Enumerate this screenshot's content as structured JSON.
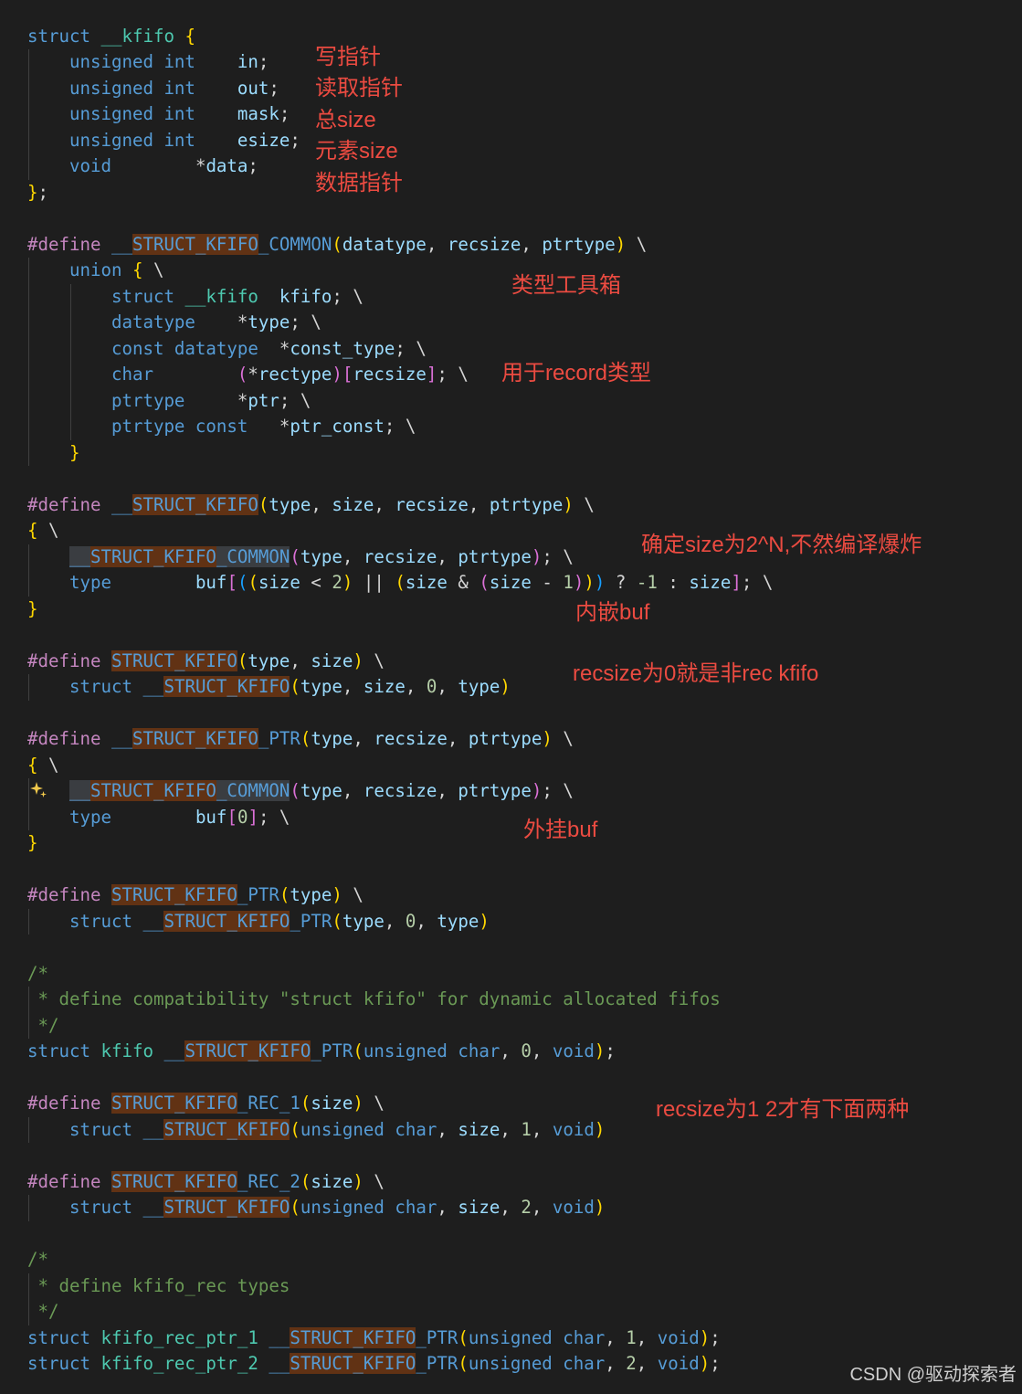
{
  "editor": {
    "theme": {
      "background": "#1e1e1e",
      "keyword": "#569cd6",
      "directive": "#c586c0",
      "macro": "#569cd6",
      "type": "#4ec9b0",
      "identifier": "#9cdcfe",
      "number": "#b5cea8",
      "punctuation": "#d4d4d4",
      "bracket1": "#ffd700",
      "bracket2": "#da70d6",
      "bracket3": "#179fff",
      "comment": "#6a9955",
      "find_match_bg": "#613214",
      "word_highlight_bg": "#3a3d41",
      "indent_guide": "#404040",
      "annotation": "#eb4b41",
      "watermark": "#cfcfcf",
      "sparkle": "#f2c94c"
    },
    "lines": [
      [
        [
          "struct ",
          "keyword"
        ],
        [
          "__kfifo ",
          "type"
        ],
        [
          "{",
          "bracket1"
        ]
      ],
      [
        [
          "    unsigned int    ",
          "keyword"
        ],
        [
          "in",
          "identifier"
        ],
        [
          ";",
          "punctuation"
        ]
      ],
      [
        [
          "    unsigned int    ",
          "keyword"
        ],
        [
          "out",
          "identifier"
        ],
        [
          ";",
          "punctuation"
        ]
      ],
      [
        [
          "    unsigned int    ",
          "keyword"
        ],
        [
          "mask",
          "identifier"
        ],
        [
          ";",
          "punctuation"
        ]
      ],
      [
        [
          "    unsigned int    ",
          "keyword"
        ],
        [
          "esize",
          "identifier"
        ],
        [
          ";",
          "punctuation"
        ]
      ],
      [
        [
          "    void        ",
          "keyword"
        ],
        [
          "*",
          "punctuation"
        ],
        [
          "data",
          "identifier"
        ],
        [
          ";",
          "punctuation"
        ]
      ],
      [
        [
          "}",
          "bracket1"
        ],
        [
          ";",
          "punctuation"
        ]
      ],
      [],
      [
        [
          "#define ",
          "directive"
        ],
        [
          "__",
          "macro"
        ],
        [
          "STRUCT_KFIFO",
          "macro",
          "find"
        ],
        [
          "_COMMON",
          "macro"
        ],
        [
          "(",
          "bracket1"
        ],
        [
          "datatype",
          "identifier"
        ],
        [
          ", ",
          "punctuation"
        ],
        [
          "recsize",
          "identifier"
        ],
        [
          ", ",
          "punctuation"
        ],
        [
          "ptrtype",
          "identifier"
        ],
        [
          ")",
          "bracket1"
        ],
        [
          " \\",
          "punctuation"
        ]
      ],
      [
        [
          "    union ",
          "keyword"
        ],
        [
          "{",
          "bracket1"
        ],
        [
          " \\",
          "punctuation"
        ]
      ],
      [
        [
          "        struct ",
          "keyword"
        ],
        [
          "__kfifo",
          "type"
        ],
        [
          "  kfifo",
          "identifier"
        ],
        [
          "; \\",
          "punctuation"
        ]
      ],
      [
        [
          "        datatype    ",
          "keyword"
        ],
        [
          "*",
          "punctuation"
        ],
        [
          "type",
          "identifier"
        ],
        [
          "; \\",
          "punctuation"
        ]
      ],
      [
        [
          "        const datatype  ",
          "keyword"
        ],
        [
          "*",
          "punctuation"
        ],
        [
          "const_type",
          "identifier"
        ],
        [
          "; \\",
          "punctuation"
        ]
      ],
      [
        [
          "        char        ",
          "keyword"
        ],
        [
          "(",
          "bracket2"
        ],
        [
          "*",
          "punctuation"
        ],
        [
          "rectype",
          "identifier"
        ],
        [
          ")",
          "bracket2"
        ],
        [
          "[",
          "bracket2"
        ],
        [
          "recsize",
          "identifier"
        ],
        [
          "]",
          "bracket2"
        ],
        [
          "; \\",
          "punctuation"
        ]
      ],
      [
        [
          "        ptrtype     ",
          "keyword"
        ],
        [
          "*",
          "punctuation"
        ],
        [
          "ptr",
          "identifier"
        ],
        [
          "; \\",
          "punctuation"
        ]
      ],
      [
        [
          "        ptrtype const   ",
          "keyword"
        ],
        [
          "*",
          "punctuation"
        ],
        [
          "ptr_const",
          "identifier"
        ],
        [
          "; \\",
          "punctuation"
        ]
      ],
      [
        [
          "    ",
          "punctuation"
        ],
        [
          "}",
          "bracket1"
        ]
      ],
      [],
      [
        [
          "#define ",
          "directive"
        ],
        [
          "__",
          "macro"
        ],
        [
          "STRUCT_KFIFO",
          "macro",
          "find"
        ],
        [
          "(",
          "bracket1"
        ],
        [
          "type",
          "identifier"
        ],
        [
          ", ",
          "punctuation"
        ],
        [
          "size",
          "identifier"
        ],
        [
          ", ",
          "punctuation"
        ],
        [
          "recsize",
          "identifier"
        ],
        [
          ", ",
          "punctuation"
        ],
        [
          "ptrtype",
          "identifier"
        ],
        [
          ")",
          "bracket1"
        ],
        [
          " \\",
          "punctuation"
        ]
      ],
      [
        [
          "{",
          "bracket1"
        ],
        [
          " \\",
          "punctuation"
        ]
      ],
      [
        [
          "    ",
          "punctuation"
        ],
        [
          "__",
          "macro",
          "word"
        ],
        [
          "STRUCT_KFIFO",
          "macro",
          "find"
        ],
        [
          "_COMMON",
          "macro",
          "word"
        ],
        [
          "(",
          "bracket2"
        ],
        [
          "type",
          "identifier"
        ],
        [
          ", ",
          "punctuation"
        ],
        [
          "recsize",
          "identifier"
        ],
        [
          ", ",
          "punctuation"
        ],
        [
          "ptrtype",
          "identifier"
        ],
        [
          ")",
          "bracket2"
        ],
        [
          "; \\",
          "punctuation"
        ]
      ],
      [
        [
          "    type        ",
          "keyword"
        ],
        [
          "buf",
          "identifier"
        ],
        [
          "[",
          "bracket2"
        ],
        [
          "(",
          "bracket3"
        ],
        [
          "(",
          "bracket1"
        ],
        [
          "size",
          "identifier"
        ],
        [
          " < ",
          "punctuation"
        ],
        [
          "2",
          "number"
        ],
        [
          ")",
          "bracket1"
        ],
        [
          " || ",
          "punctuation"
        ],
        [
          "(",
          "bracket1"
        ],
        [
          "size",
          "identifier"
        ],
        [
          " & ",
          "punctuation"
        ],
        [
          "(",
          "bracket2"
        ],
        [
          "size",
          "identifier"
        ],
        [
          " - ",
          "punctuation"
        ],
        [
          "1",
          "number"
        ],
        [
          ")",
          "bracket2"
        ],
        [
          ")",
          "bracket1"
        ],
        [
          ")",
          "bracket3"
        ],
        [
          " ? ",
          "punctuation"
        ],
        [
          "-1",
          "number"
        ],
        [
          " : ",
          "punctuation"
        ],
        [
          "size",
          "identifier"
        ],
        [
          "]",
          "bracket2"
        ],
        [
          "; \\",
          "punctuation"
        ]
      ],
      [
        [
          "}",
          "bracket1"
        ]
      ],
      [],
      [
        [
          "#define ",
          "directive"
        ],
        [
          "STRUCT_KFIFO",
          "macro",
          "find"
        ],
        [
          "(",
          "bracket1"
        ],
        [
          "type",
          "identifier"
        ],
        [
          ", ",
          "punctuation"
        ],
        [
          "size",
          "identifier"
        ],
        [
          ")",
          "bracket1"
        ],
        [
          " \\",
          "punctuation"
        ]
      ],
      [
        [
          "    struct ",
          "keyword"
        ],
        [
          "__",
          "macro"
        ],
        [
          "STRUCT_KFIFO",
          "macro",
          "find"
        ],
        [
          "(",
          "bracket1"
        ],
        [
          "type",
          "identifier"
        ],
        [
          ", ",
          "punctuation"
        ],
        [
          "size",
          "identifier"
        ],
        [
          ", ",
          "punctuation"
        ],
        [
          "0",
          "number"
        ],
        [
          ", ",
          "punctuation"
        ],
        [
          "type",
          "identifier"
        ],
        [
          ")",
          "bracket1"
        ]
      ],
      [],
      [
        [
          "#define ",
          "directive"
        ],
        [
          "__",
          "macro"
        ],
        [
          "STRUCT_KFIFO",
          "macro",
          "find"
        ],
        [
          "_PTR",
          "macro"
        ],
        [
          "(",
          "bracket1"
        ],
        [
          "type",
          "identifier"
        ],
        [
          ", ",
          "punctuation"
        ],
        [
          "recsize",
          "identifier"
        ],
        [
          ", ",
          "punctuation"
        ],
        [
          "ptrtype",
          "identifier"
        ],
        [
          ")",
          "bracket1"
        ],
        [
          " \\",
          "punctuation"
        ]
      ],
      [
        [
          "{",
          "bracket1"
        ],
        [
          " \\",
          "punctuation"
        ]
      ],
      [
        [
          "    ",
          "punctuation"
        ],
        [
          "__",
          "macro",
          "word"
        ],
        [
          "STRUCT_KFIFO",
          "macro",
          "find"
        ],
        [
          "_COMMON",
          "macro",
          "word"
        ],
        [
          "(",
          "bracket2"
        ],
        [
          "type",
          "identifier"
        ],
        [
          ", ",
          "punctuation"
        ],
        [
          "recsize",
          "identifier"
        ],
        [
          ", ",
          "punctuation"
        ],
        [
          "ptrtype",
          "identifier"
        ],
        [
          ")",
          "bracket2"
        ],
        [
          "; \\",
          "punctuation"
        ]
      ],
      [
        [
          "    type        ",
          "keyword"
        ],
        [
          "buf",
          "identifier"
        ],
        [
          "[",
          "bracket2"
        ],
        [
          "0",
          "number"
        ],
        [
          "]",
          "bracket2"
        ],
        [
          "; \\",
          "punctuation"
        ]
      ],
      [
        [
          "}",
          "bracket1"
        ]
      ],
      [],
      [
        [
          "#define ",
          "directive"
        ],
        [
          "STRUCT_KFIFO",
          "macro",
          "find"
        ],
        [
          "_PTR",
          "macro"
        ],
        [
          "(",
          "bracket1"
        ],
        [
          "type",
          "identifier"
        ],
        [
          ")",
          "bracket1"
        ],
        [
          " \\",
          "punctuation"
        ]
      ],
      [
        [
          "    struct ",
          "keyword"
        ],
        [
          "__",
          "macro"
        ],
        [
          "STRUCT_KFIFO",
          "macro",
          "find"
        ],
        [
          "_PTR",
          "macro"
        ],
        [
          "(",
          "bracket1"
        ],
        [
          "type",
          "identifier"
        ],
        [
          ", ",
          "punctuation"
        ],
        [
          "0",
          "number"
        ],
        [
          ", ",
          "punctuation"
        ],
        [
          "type",
          "identifier"
        ],
        [
          ")",
          "bracket1"
        ]
      ],
      [],
      [
        [
          "/*",
          "comment"
        ]
      ],
      [
        [
          " * define compatibility \"struct kfifo\" for dynamic allocated fifos",
          "comment"
        ]
      ],
      [
        [
          " */",
          "comment"
        ]
      ],
      [
        [
          "struct ",
          "keyword"
        ],
        [
          "kfifo ",
          "type"
        ],
        [
          "__",
          "macro"
        ],
        [
          "STRUCT_KFIFO",
          "macro",
          "find"
        ],
        [
          "_PTR",
          "macro"
        ],
        [
          "(",
          "bracket1"
        ],
        [
          "unsigned char",
          "keyword"
        ],
        [
          ", ",
          "punctuation"
        ],
        [
          "0",
          "number"
        ],
        [
          ", ",
          "punctuation"
        ],
        [
          "void",
          "keyword"
        ],
        [
          ")",
          "bracket1"
        ],
        [
          ";",
          "punctuation"
        ]
      ],
      [],
      [
        [
          "#define ",
          "directive"
        ],
        [
          "STRUCT_KFIFO",
          "macro",
          "find"
        ],
        [
          "_REC_1",
          "macro"
        ],
        [
          "(",
          "bracket1"
        ],
        [
          "size",
          "identifier"
        ],
        [
          ")",
          "bracket1"
        ],
        [
          " \\",
          "punctuation"
        ]
      ],
      [
        [
          "    struct ",
          "keyword"
        ],
        [
          "__",
          "macro"
        ],
        [
          "STRUCT_KFIFO",
          "macro",
          "find"
        ],
        [
          "(",
          "bracket1"
        ],
        [
          "unsigned char",
          "keyword"
        ],
        [
          ", ",
          "punctuation"
        ],
        [
          "size",
          "identifier"
        ],
        [
          ", ",
          "punctuation"
        ],
        [
          "1",
          "number"
        ],
        [
          ", ",
          "punctuation"
        ],
        [
          "void",
          "keyword"
        ],
        [
          ")",
          "bracket1"
        ]
      ],
      [],
      [
        [
          "#define ",
          "directive"
        ],
        [
          "STRUCT_KFIFO",
          "macro",
          "find"
        ],
        [
          "_REC_2",
          "macro"
        ],
        [
          "(",
          "bracket1"
        ],
        [
          "size",
          "identifier"
        ],
        [
          ")",
          "bracket1"
        ],
        [
          " \\",
          "punctuation"
        ]
      ],
      [
        [
          "    struct ",
          "keyword"
        ],
        [
          "__",
          "macro"
        ],
        [
          "STRUCT_KFIFO",
          "macro",
          "find"
        ],
        [
          "(",
          "bracket1"
        ],
        [
          "unsigned char",
          "keyword"
        ],
        [
          ", ",
          "punctuation"
        ],
        [
          "size",
          "identifier"
        ],
        [
          ", ",
          "punctuation"
        ],
        [
          "2",
          "number"
        ],
        [
          ", ",
          "punctuation"
        ],
        [
          "void",
          "keyword"
        ],
        [
          ")",
          "bracket1"
        ]
      ],
      [],
      [
        [
          "/*",
          "comment"
        ]
      ],
      [
        [
          " * define kfifo_rec types",
          "comment"
        ]
      ],
      [
        [
          " */",
          "comment"
        ]
      ],
      [
        [
          "struct ",
          "keyword"
        ],
        [
          "kfifo_rec_ptr_1 ",
          "type"
        ],
        [
          "__",
          "macro"
        ],
        [
          "STRUCT_KFIFO",
          "macro",
          "find"
        ],
        [
          "_PTR",
          "macro"
        ],
        [
          "(",
          "bracket1"
        ],
        [
          "unsigned char",
          "keyword"
        ],
        [
          ", ",
          "punctuation"
        ],
        [
          "1",
          "number"
        ],
        [
          ", ",
          "punctuation"
        ],
        [
          "void",
          "keyword"
        ],
        [
          ")",
          "bracket1"
        ],
        [
          ";",
          "punctuation"
        ]
      ],
      [
        [
          "struct ",
          "keyword"
        ],
        [
          "kfifo_rec_ptr_2 ",
          "type"
        ],
        [
          "__",
          "macro"
        ],
        [
          "STRUCT_KFIFO",
          "macro",
          "find"
        ],
        [
          "_PTR",
          "macro"
        ],
        [
          "(",
          "bracket1"
        ],
        [
          "unsigned char",
          "keyword"
        ],
        [
          ", ",
          "punctuation"
        ],
        [
          "2",
          "number"
        ],
        [
          ", ",
          "punctuation"
        ],
        [
          "void",
          "keyword"
        ],
        [
          ")",
          "bracket1"
        ],
        [
          ";",
          "punctuation"
        ]
      ]
    ]
  },
  "icons": {
    "inline_action": "sparkle-icon"
  },
  "annotations": [
    "写指针",
    "读取指针",
    "总size",
    "元素size",
    "数据指针",
    "类型工具箱",
    "用于record类型",
    "确定size为2^N,不然编译爆炸",
    "内嵌buf",
    "recsize为0就是非rec kfifo",
    "外挂buf",
    "recsize为1 2才有下面两种"
  ],
  "watermark": "CSDN @驱动探索者"
}
